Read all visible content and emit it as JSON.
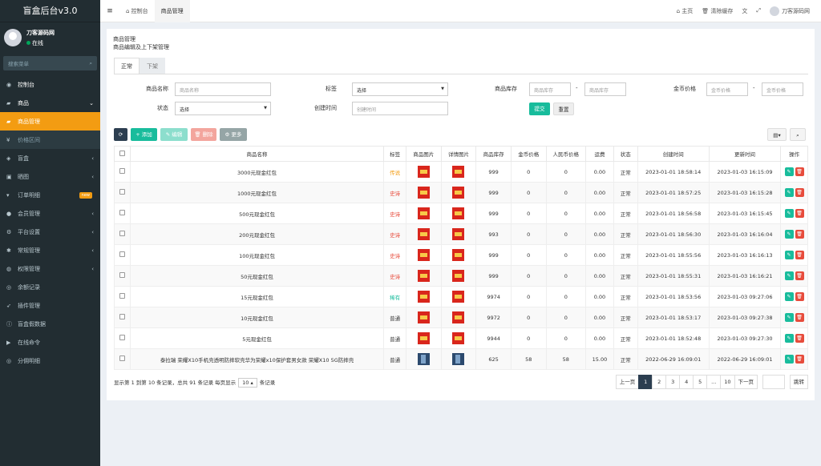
{
  "app": {
    "logo": "盲盒后台v3.0",
    "user": "刀客源码网",
    "status": "在线",
    "search_placeholder": "搜索菜单"
  },
  "sidebar": [
    {
      "label": "控制台",
      "icon": "dashboard-icon",
      "arrow": ""
    },
    {
      "label": "商品",
      "icon": "briefcase-icon",
      "arrow": "⌄"
    },
    {
      "label": "商品管理",
      "icon": "briefcase-icon",
      "arrow": "",
      "active": true
    },
    {
      "label": "价格区间",
      "icon": "price-icon",
      "arrow": "",
      "sub": true
    },
    {
      "label": "盲盒",
      "icon": "box-icon",
      "arrow": "‹"
    },
    {
      "label": "晒图",
      "icon": "image-icon",
      "arrow": "‹"
    },
    {
      "label": "订单明细",
      "icon": "cart-icon",
      "arrow": "",
      "badge": "new"
    },
    {
      "label": "会员管理",
      "icon": "user-icon",
      "arrow": "‹"
    },
    {
      "label": "平台设置",
      "icon": "gear-icon",
      "arrow": "‹"
    },
    {
      "label": "常规管理",
      "icon": "cog-icon",
      "arrow": "‹"
    },
    {
      "label": "权限管理",
      "icon": "group-icon",
      "arrow": "‹"
    },
    {
      "label": "余额记录",
      "icon": "users-icon",
      "arrow": ""
    },
    {
      "label": "插件管理",
      "icon": "rocket-icon",
      "arrow": ""
    },
    {
      "label": "盲盒假数据",
      "icon": "info-icon",
      "arrow": ""
    },
    {
      "label": "在线命令",
      "icon": "terminal-icon",
      "arrow": ""
    },
    {
      "label": "分佣明细",
      "icon": "users-icon",
      "arrow": ""
    }
  ],
  "topbar": {
    "tab_console": "控制台",
    "tab_goods": "商品管理",
    "home": "主页",
    "clear_cache": "清除缓存",
    "user": "刀客源码网"
  },
  "page": {
    "title": "商品管理",
    "subtitle": "商品编辑及上下架管理",
    "tab_normal": "正常",
    "tab_off": "下架"
  },
  "form": {
    "name_label": "商品名称",
    "name_ph": "商品名称",
    "tag_label": "标签",
    "tag_value": "选择",
    "stock_label": "商品库存",
    "stock_ph": "商品库存",
    "coin_label": "金币价格",
    "coin_ph": "金币价格",
    "status_label": "状态",
    "status_value": "选择",
    "time_label": "创建时间",
    "time_ph": "创建时间",
    "submit": "提交",
    "reset": "重置"
  },
  "toolbar": {
    "add": "添加",
    "edit": "编辑",
    "delete": "删除",
    "more": "更多"
  },
  "columns": [
    "商品名称",
    "标签",
    "商品图片",
    "详情图片",
    "商品库存",
    "金币价格",
    "人民币价格",
    "运费",
    "状态",
    "创建时间",
    "更新时间",
    "操作"
  ],
  "rows": [
    {
      "name": "3000元现金红包",
      "tag": "传说",
      "tag_color": "#f39c12",
      "img": "red",
      "stock": "999",
      "coin": "0",
      "rmb": "0",
      "ship": "0.00",
      "status": "正常",
      "created": "2023-01-01 18:58:14",
      "updated": "2023-01-03 16:15:09"
    },
    {
      "name": "1000元现金红包",
      "tag": "史诗",
      "tag_color": "#e74c3c",
      "img": "red",
      "stock": "999",
      "coin": "0",
      "rmb": "0",
      "ship": "0.00",
      "status": "正常",
      "created": "2023-01-01 18:57:25",
      "updated": "2023-01-03 16:15:28"
    },
    {
      "name": "500元现金红包",
      "tag": "史诗",
      "tag_color": "#e74c3c",
      "img": "red",
      "stock": "999",
      "coin": "0",
      "rmb": "0",
      "ship": "0.00",
      "status": "正常",
      "created": "2023-01-01 18:56:58",
      "updated": "2023-01-03 16:15:45"
    },
    {
      "name": "200元现金红包",
      "tag": "史诗",
      "tag_color": "#e74c3c",
      "img": "red",
      "stock": "993",
      "coin": "0",
      "rmb": "0",
      "ship": "0.00",
      "status": "正常",
      "created": "2023-01-01 18:56:30",
      "updated": "2023-01-03 16:16:04"
    },
    {
      "name": "100元现金红包",
      "tag": "史诗",
      "tag_color": "#e74c3c",
      "img": "red",
      "stock": "999",
      "coin": "0",
      "rmb": "0",
      "ship": "0.00",
      "status": "正常",
      "created": "2023-01-01 18:55:56",
      "updated": "2023-01-03 16:16:13"
    },
    {
      "name": "50元现金红包",
      "tag": "史诗",
      "tag_color": "#e74c3c",
      "img": "red",
      "stock": "999",
      "coin": "0",
      "rmb": "0",
      "ship": "0.00",
      "status": "正常",
      "created": "2023-01-01 18:55:31",
      "updated": "2023-01-03 16:16:21"
    },
    {
      "name": "15元现金红包",
      "tag": "稀有",
      "tag_color": "#18bc9c",
      "img": "red",
      "stock": "9974",
      "coin": "0",
      "rmb": "0",
      "ship": "0.00",
      "status": "正常",
      "created": "2023-01-01 18:53:56",
      "updated": "2023-01-03 09:27:06"
    },
    {
      "name": "10元现金红包",
      "tag": "普通",
      "tag_color": "#333333",
      "img": "red",
      "stock": "9972",
      "coin": "0",
      "rmb": "0",
      "ship": "0.00",
      "status": "正常",
      "created": "2023-01-01 18:53:17",
      "updated": "2023-01-03 09:27:38"
    },
    {
      "name": "5元现金红包",
      "tag": "普通",
      "tag_color": "#333333",
      "img": "red",
      "stock": "9944",
      "coin": "0",
      "rmb": "0",
      "ship": "0.00",
      "status": "正常",
      "created": "2023-01-01 18:52:48",
      "updated": "2023-01-03 09:27:30"
    },
    {
      "name": "泰拉瑞 荣耀X10手机壳透明防摔软壳华为荣耀x10保护套男女款 荣耀X10 5G防摔壳",
      "tag": "普通",
      "tag_color": "#333333",
      "img": "photo",
      "stock": "625",
      "coin": "58",
      "rmb": "58",
      "ship": "15.00",
      "status": "正常",
      "created": "2022-06-29 16:09:01",
      "updated": "2022-06-29 16:09:01"
    }
  ],
  "pagination": {
    "info_a": "显示第 1 到第 10 条记录，总共 91 条记录 每页显示",
    "size": "10",
    "info_b": "条记录",
    "prev": "上一页",
    "pages": [
      "1",
      "2",
      "3",
      "4",
      "5",
      "...",
      "10"
    ],
    "next": "下一页",
    "jump": "跳转"
  }
}
